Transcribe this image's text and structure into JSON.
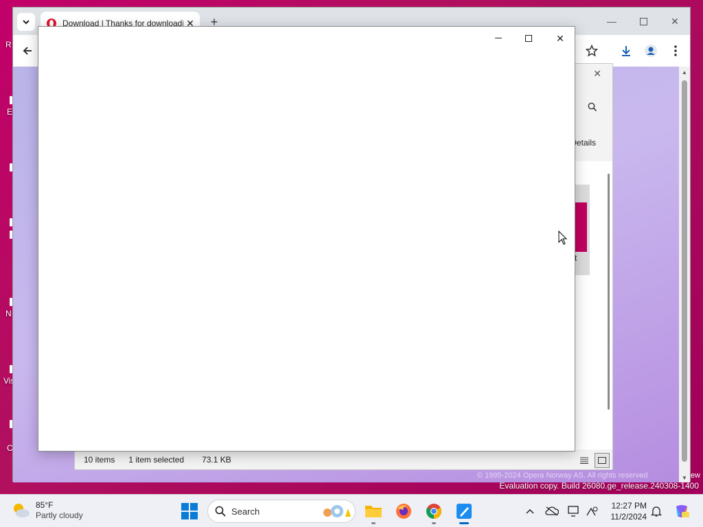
{
  "desktop": {
    "labels": [
      "R",
      "E",
      "N",
      "Vis",
      "C"
    ],
    "evaluation_text": "Evaluation copy. Build 26080.ge_release.240308-1400",
    "edge_text": "ew"
  },
  "browser": {
    "tab_title": "Download | Thanks for downloading Opera",
    "footer_text": "© 1995-2024 Opera Norway AS. All rights reserved"
  },
  "explorer": {
    "details_label": "Details",
    "file_label": "t",
    "status": {
      "item_count": "10 items",
      "selected": "1 item selected",
      "size": "73.1 KB"
    }
  },
  "taskbar": {
    "weather": {
      "temp": "85°F",
      "desc": "Partly cloudy"
    },
    "search_placeholder": "Search",
    "time": "12:27 PM",
    "date": "11/2/2024"
  },
  "colors": {
    "wallpaper": "#b8005c",
    "opera_red": "#e0112b",
    "accent": "#0067c0"
  }
}
